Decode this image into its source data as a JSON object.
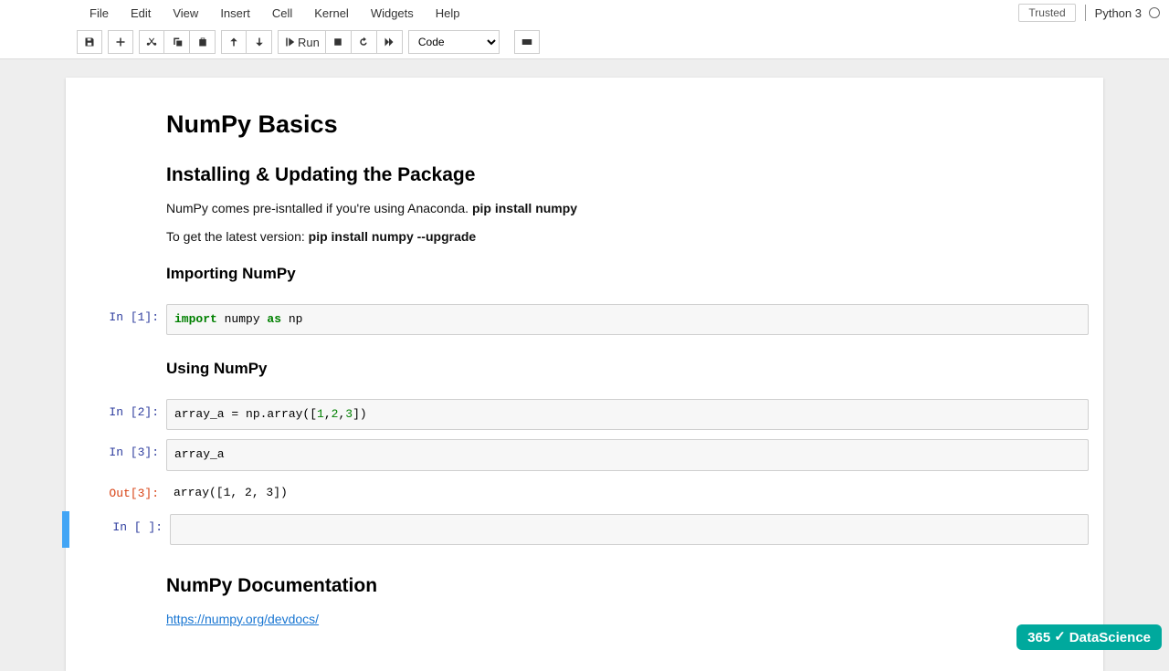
{
  "menu": {
    "items": [
      "File",
      "Edit",
      "View",
      "Insert",
      "Cell",
      "Kernel",
      "Widgets",
      "Help"
    ],
    "trusted": "Trusted",
    "kernel": "Python 3"
  },
  "toolbar": {
    "run_label": "Run",
    "cell_type_selected": "Code"
  },
  "content": {
    "h1": "NumPy Basics",
    "h2_install": "Installing & Updating the Package",
    "p_install_1_a": "NumPy comes pre-isntalled if you're using Anaconda. ",
    "p_install_1_b": "pip install numpy",
    "p_install_2_a": "To get the latest version: ",
    "p_install_2_b": "pip install numpy --upgrade",
    "h3_import": "Importing NumPy",
    "h3_using": "Using NumPy",
    "h2_doc": "NumPy Documentation",
    "doc_link": "https://numpy.org/devdocs/"
  },
  "cells": {
    "in1_prompt": "In [1]:",
    "in1_code_kw1": "import",
    "in1_code_t1": " numpy ",
    "in1_code_kw2": "as",
    "in1_code_t2": " np",
    "in2_prompt": "In [2]:",
    "in2_code_a": "array_a = np.array([",
    "in2_code_n1": "1",
    "in2_code_c1": ",",
    "in2_code_n2": "2",
    "in2_code_c2": ",",
    "in2_code_n3": "3",
    "in2_code_b": "])",
    "in3_prompt": "In [3]:",
    "in3_code": "array_a",
    "out3_prompt": "Out[3]:",
    "out3_text": "array([1, 2, 3])",
    "in4_prompt": "In [ ]:",
    "in4_code": " "
  },
  "watermark": {
    "a": "365",
    "b": "DataScience"
  }
}
